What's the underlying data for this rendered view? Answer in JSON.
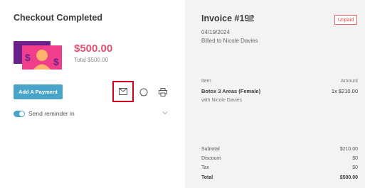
{
  "checkout": {
    "title": "Checkout Completed",
    "amount": "$500.00",
    "total_label": "Total $500.00",
    "add_payment_label": "Add A Payment",
    "reminder_label": "Send reminder in"
  },
  "invoice": {
    "title": "Invoice #192",
    "status": "Unpaid",
    "date": "04/19/2024",
    "billed_to": "Billed to Nicole Davies",
    "col_item": "Item",
    "col_amount": "Amount",
    "line_items": [
      {
        "name": "Botox 3 Areas (Female)",
        "amount": "1x $210.00",
        "subtitle": "with Nicole Davies"
      }
    ],
    "summary": [
      {
        "label": "Subtotal",
        "value": "$210.00"
      },
      {
        "label": "Discount",
        "value": "$0"
      },
      {
        "label": "Tax",
        "value": "$0"
      },
      {
        "label": "Total",
        "value": "$500.00"
      }
    ]
  },
  "colors": {
    "accent": "#4aa3c8",
    "amount": "#e0506f",
    "highlight": "#d0021b",
    "unpaid": "#d94848"
  }
}
